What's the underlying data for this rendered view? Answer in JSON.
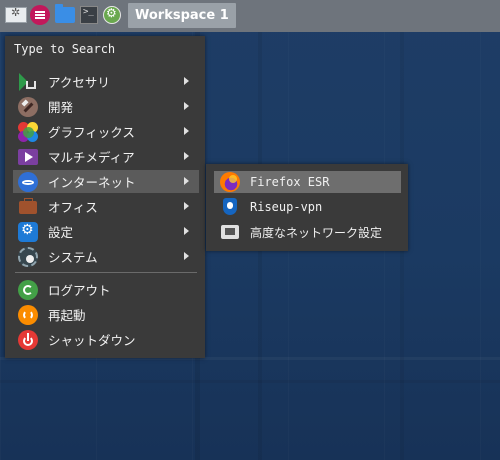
{
  "panel": {
    "workspace_label": "Workspace 1",
    "launchers": [
      {
        "icon": "application-icon"
      },
      {
        "icon": "menu-icon"
      },
      {
        "icon": "folder-icon"
      },
      {
        "icon": "terminal-icon"
      },
      {
        "icon": "settings-gear-icon"
      }
    ]
  },
  "menu": {
    "search_placeholder": "Type to Search",
    "categories": [
      {
        "label": "アクセサリ",
        "icon": "accessories-icon",
        "has_submenu": true
      },
      {
        "label": "開発",
        "icon": "development-icon",
        "has_submenu": true
      },
      {
        "label": "グラフィックス",
        "icon": "graphics-icon",
        "has_submenu": true
      },
      {
        "label": "マルチメディア",
        "icon": "multimedia-icon",
        "has_submenu": true
      },
      {
        "label": "インターネット",
        "icon": "internet-icon",
        "has_submenu": true,
        "active": true
      },
      {
        "label": "オフィス",
        "icon": "office-icon",
        "has_submenu": true
      },
      {
        "label": "設定",
        "icon": "settings-icon",
        "has_submenu": true
      },
      {
        "label": "システム",
        "icon": "system-icon",
        "has_submenu": true
      }
    ],
    "actions": [
      {
        "label": "ログアウト",
        "icon": "logout-icon"
      },
      {
        "label": "再起動",
        "icon": "restart-icon"
      },
      {
        "label": "シャットダウン",
        "icon": "shutdown-icon"
      }
    ]
  },
  "submenu": {
    "items": [
      {
        "label": "Firefox ESR",
        "icon": "firefox-icon",
        "active": true
      },
      {
        "label": "Riseup-vpn",
        "icon": "riseup-vpn-icon"
      },
      {
        "label": "高度なネットワーク設定",
        "icon": "network-settings-icon"
      }
    ]
  },
  "colors": {
    "desktop_bg": "#1e3d66",
    "panel_bg": "#6e747c",
    "menu_bg": "#3a3a3a",
    "highlight": "#5b5b5b"
  }
}
